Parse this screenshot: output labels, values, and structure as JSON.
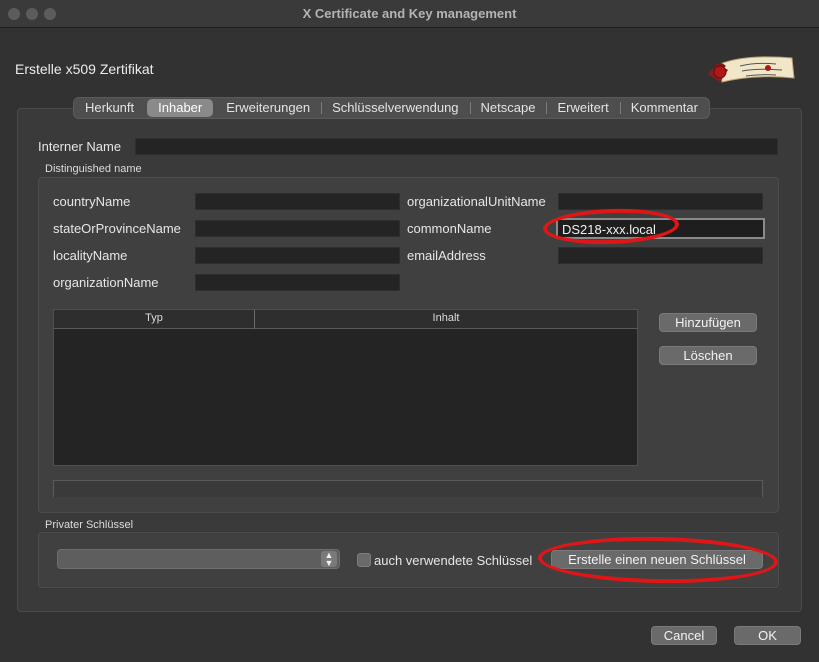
{
  "window": {
    "title": "X Certificate and Key management"
  },
  "dialog": {
    "heading": "Erstelle x509 Zertifikat"
  },
  "tabs": [
    {
      "label": "Herkunft"
    },
    {
      "label": "Inhaber"
    },
    {
      "label": "Erweiterungen"
    },
    {
      "label": "Schlüsselverwendung"
    },
    {
      "label": "Netscape"
    },
    {
      "label": "Erweitert"
    },
    {
      "label": "Kommentar"
    }
  ],
  "active_tab": "Inhaber",
  "internal_name": {
    "label": "Interner Name",
    "value": ""
  },
  "distinguished_name": {
    "group_label": "Distinguished name",
    "fields": {
      "countryName": {
        "label": "countryName",
        "value": ""
      },
      "stateOrProvinceName": {
        "label": "stateOrProvinceName",
        "value": ""
      },
      "localityName": {
        "label": "localityName",
        "value": ""
      },
      "organizationName": {
        "label": "organizationName",
        "value": ""
      },
      "organizationalUnitName": {
        "label": "organizationalUnitName",
        "value": ""
      },
      "commonName": {
        "label": "commonName",
        "value": "DS218-xxx.local"
      },
      "emailAddress": {
        "label": "emailAddress",
        "value": ""
      }
    },
    "table": {
      "columns": [
        "Typ",
        "Inhalt"
      ],
      "rows": []
    },
    "add_button": "Hinzufügen",
    "delete_button": "Löschen"
  },
  "private_key": {
    "group_label": "Privater Schlüssel",
    "selected_key": "",
    "checkbox_label": "auch verwendete Schlüssel",
    "checkbox_checked": false,
    "create_button": "Erstelle einen neuen Schlüssel"
  },
  "footer": {
    "cancel": "Cancel",
    "ok": "OK"
  },
  "colors": {
    "annotation": "#e01616",
    "background": "#323232"
  }
}
